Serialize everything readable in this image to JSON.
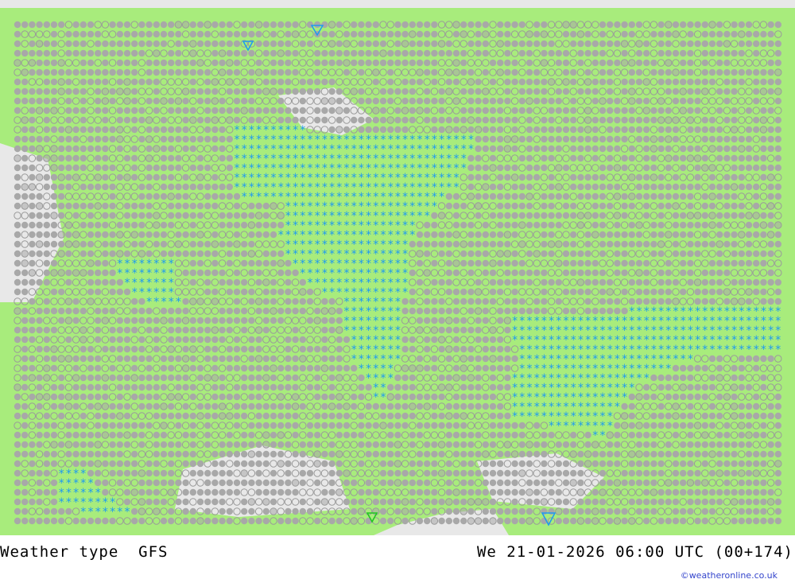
{
  "map": {
    "product": "Weather type",
    "model": "GFS",
    "valid_time": "We 21-01-2026 06:00 UTC (00+174)",
    "credit": "©weatheronline.co.uk",
    "colors": {
      "sea": "#e8e8e8",
      "land": "#a8ec7c",
      "overcast": "#a8a8a8",
      "cloud_outline": "#9a9a9a",
      "snow": "#1e9af0",
      "shower": "#1ec81e"
    },
    "legend_symbols": {
      "filled_circle": "overcast",
      "open_circle": "partly cloudy",
      "asterisk": "snow",
      "triangle": "shower"
    }
  }
}
